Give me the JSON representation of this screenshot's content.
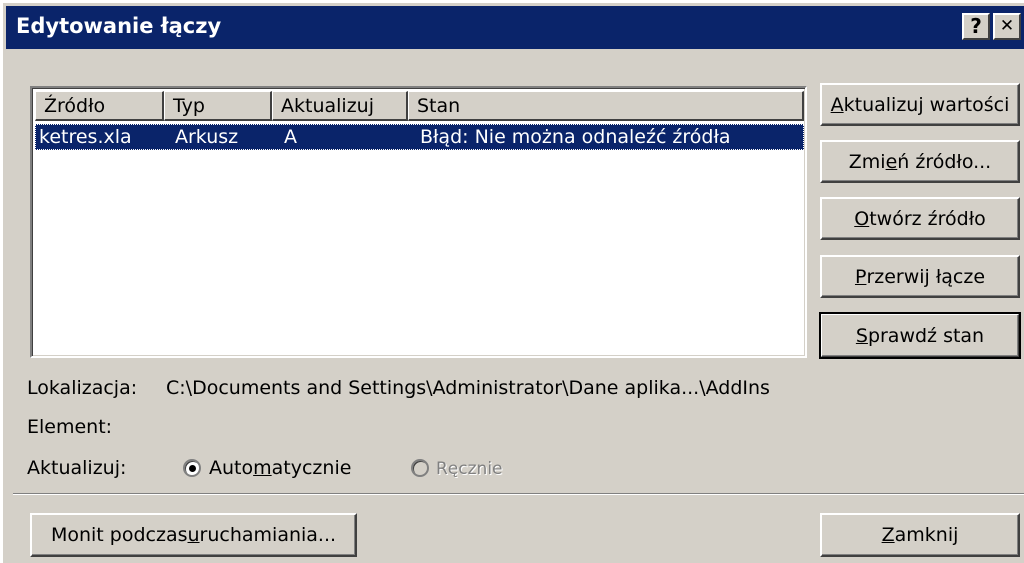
{
  "window": {
    "title": "Edytowanie łączy",
    "help_label": "?",
    "close_label": "✕"
  },
  "links_table": {
    "columns": [
      "Źródło",
      "Typ",
      "Aktualizuj",
      "Stan"
    ],
    "rows": [
      {
        "source": "ketres.xla",
        "type": "Arkusz",
        "update": "A",
        "status": "Błąd: Nie można odnaleźć źródła"
      }
    ]
  },
  "buttons": {
    "update_values": {
      "pre": "",
      "key": "A",
      "post": "ktualizuj wartości"
    },
    "change_source": {
      "pre": "Zmi",
      "key": "e",
      "post": "ń źródło..."
    },
    "open_source": {
      "pre": "",
      "key": "O",
      "post": "twórz źródło"
    },
    "break_link": {
      "pre": "",
      "key": "P",
      "post": "rzerwij łącze"
    },
    "check_status": {
      "pre": "",
      "key": "S",
      "post": "prawdź stan"
    },
    "startup_prompt": {
      "pre": "Monit podczas ",
      "key": "u",
      "post": "ruchamiania..."
    },
    "close": {
      "pre": "",
      "key": "Z",
      "post": "amknij"
    }
  },
  "details": {
    "location_label": "Lokalizacja:",
    "location_value": "C:\\Documents and Settings\\Administrator\\Dane aplika...\\AddIns",
    "item_label": "Element:",
    "item_value": "",
    "update_label": "Aktualizuj:"
  },
  "update_mode": {
    "automatic": {
      "pre": "Auto",
      "key": "m",
      "post": "atycznie",
      "selected": true
    },
    "manual": {
      "label": "Ręcznie",
      "enabled": false
    }
  }
}
